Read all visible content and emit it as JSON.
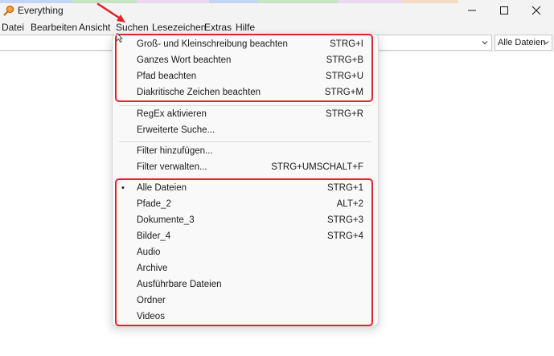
{
  "window": {
    "title": "Everything",
    "accent_colors": [
      "#c3d4f4",
      "#c6e3c4",
      "#ead7f1",
      "#f4dcc4"
    ]
  },
  "menubar": {
    "items": [
      "Datei",
      "Bearbeiten",
      "Ansicht",
      "Suchen",
      "Lesezeichen",
      "Extras",
      "Hilfe"
    ]
  },
  "search": {
    "value": "",
    "filter_selected": "Alle Dateien"
  },
  "dropdown": {
    "group1": [
      {
        "label": "Groß- und Kleinschreibung beachten",
        "shortcut": "STRG+I"
      },
      {
        "label": "Ganzes Wort beachten",
        "shortcut": "STRG+B"
      },
      {
        "label": "Pfad beachten",
        "shortcut": "STRG+U"
      },
      {
        "label": "Diakritische Zeichen beachten",
        "shortcut": "STRG+M"
      }
    ],
    "group2": [
      {
        "label": "RegEx aktivieren",
        "shortcut": "STRG+R"
      },
      {
        "label": "Erweiterte Suche...",
        "shortcut": ""
      }
    ],
    "group3": [
      {
        "label": "Filter hinzufügen...",
        "shortcut": ""
      },
      {
        "label": "Filter verwalten...",
        "shortcut": "STRG+UMSCHALT+F"
      }
    ],
    "filters": [
      {
        "label": "Alle Dateien",
        "shortcut": "STRG+1",
        "bullet": "•"
      },
      {
        "label": "Pfade_2",
        "shortcut": "ALT+2",
        "bullet": ""
      },
      {
        "label": "Dokumente_3",
        "shortcut": "STRG+3",
        "bullet": ""
      },
      {
        "label": "Bilder_4",
        "shortcut": "STRG+4",
        "bullet": ""
      },
      {
        "label": "Audio",
        "shortcut": "",
        "bullet": ""
      },
      {
        "label": "Archive",
        "shortcut": "",
        "bullet": ""
      },
      {
        "label": "Ausführbare Dateien",
        "shortcut": "",
        "bullet": ""
      },
      {
        "label": "Ordner",
        "shortcut": "",
        "bullet": ""
      },
      {
        "label": "Videos",
        "shortcut": "",
        "bullet": ""
      }
    ]
  },
  "annotation_color": "#e0242b"
}
